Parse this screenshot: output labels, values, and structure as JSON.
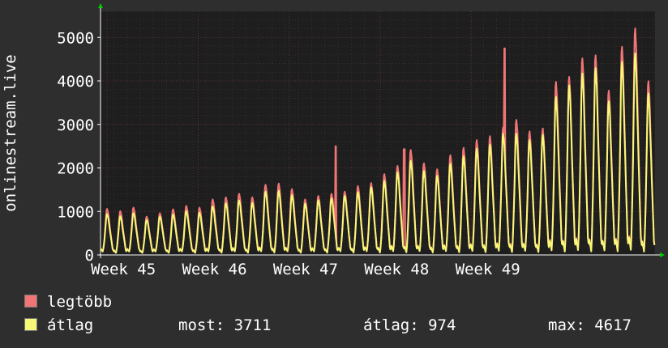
{
  "chart_data": {
    "type": "line",
    "ylabel": "onlinestream.live",
    "ylim": [
      0,
      5600
    ],
    "yticks": [
      0,
      1000,
      2000,
      3000,
      4000,
      5000
    ],
    "xticks": [
      "Week 45",
      "Week 46",
      "Week 47",
      "Week 48",
      "Week 49"
    ],
    "grid": true,
    "legend_placement": "bottom-left",
    "colors": {
      "background": "#2e2e2e",
      "plot_background": "#1e1e1e",
      "grid": "#5a3232",
      "axis": "#ffffff",
      "legtobb": "#f07676",
      "atlag": "#f8f878"
    },
    "series": [
      {
        "name": "legtöbb",
        "color": "#f07676",
        "daily_peaks": [
          1000,
          980,
          1030,
          850,
          900,
          1020,
          1070,
          1060,
          1220,
          1300,
          1350,
          1300,
          1560,
          1620,
          1460,
          1250,
          1300,
          1380,
          1400,
          1560,
          1600,
          1840,
          2000,
          2400,
          2060,
          1950,
          2250,
          2450,
          2600,
          2720,
          2900,
          3100,
          2800,
          2900,
          3950,
          4100,
          4500,
          4600,
          3750,
          4800,
          5200,
          4000
        ]
      },
      {
        "name": "átlag",
        "color": "#f8f878",
        "daily_peaks": [
          880,
          860,
          900,
          770,
          820,
          900,
          950,
          940,
          1060,
          1160,
          1200,
          1170,
          1400,
          1450,
          1320,
          1150,
          1200,
          1270,
          1300,
          1420,
          1500,
          1680,
          1850,
          2150,
          1880,
          1800,
          2050,
          2250,
          2400,
          2520,
          2750,
          2780,
          2600,
          2750,
          3600,
          3900,
          4150,
          4300,
          3500,
          4450,
          4617,
          3711
        ]
      }
    ],
    "spikes_legtobb": [
      {
        "day": 17.8,
        "value": 2500
      },
      {
        "day": 23.0,
        "value": 2430
      },
      {
        "day": 30.6,
        "value": 4750
      }
    ]
  },
  "legend": [
    {
      "name": "legtöbb",
      "color": "#f07676"
    },
    {
      "name": "átlag",
      "color": "#f8f878"
    }
  ],
  "stats": {
    "most": "most: 3711",
    "atlag": "átlag: 974",
    "max": "max: 4617"
  }
}
